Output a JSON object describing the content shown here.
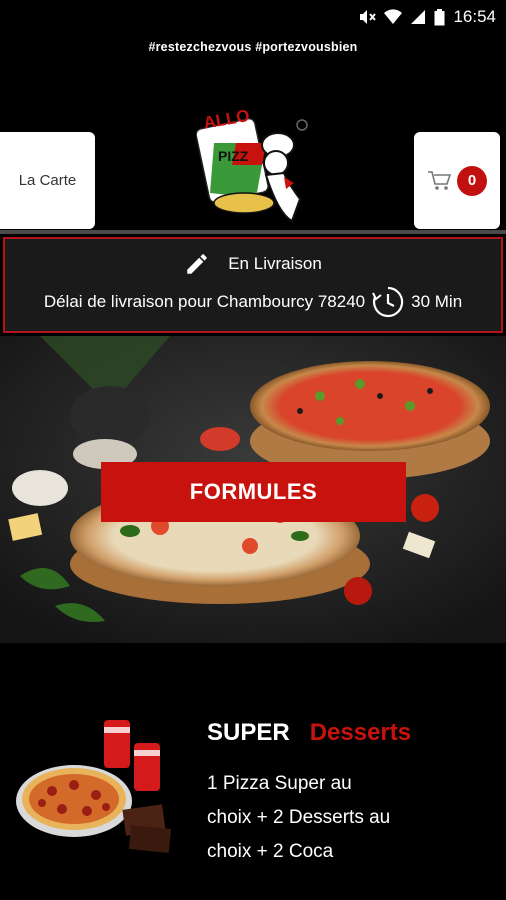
{
  "status_bar": {
    "time": "16:54"
  },
  "hashtag": "#restezchezvous #portezvousbien",
  "nav": {
    "carte_label": "La Carte",
    "cart_count": "0"
  },
  "delivery": {
    "mode": "En Livraison",
    "delay_text": "Délai de livraison pour Chambourcy 78240",
    "delay_time": "30 Min"
  },
  "hero": {
    "button_label": "FORMULES"
  },
  "product": {
    "title": "SUPER",
    "subtitle": "Desserts",
    "description": "1 Pizza Super au choix + 2 Desserts au choix + 2 Coca"
  },
  "logo_text": {
    "allo": "ALLO",
    "pizza": "PIZZ"
  },
  "colors": {
    "accent": "#c8120d",
    "background": "#000000"
  }
}
